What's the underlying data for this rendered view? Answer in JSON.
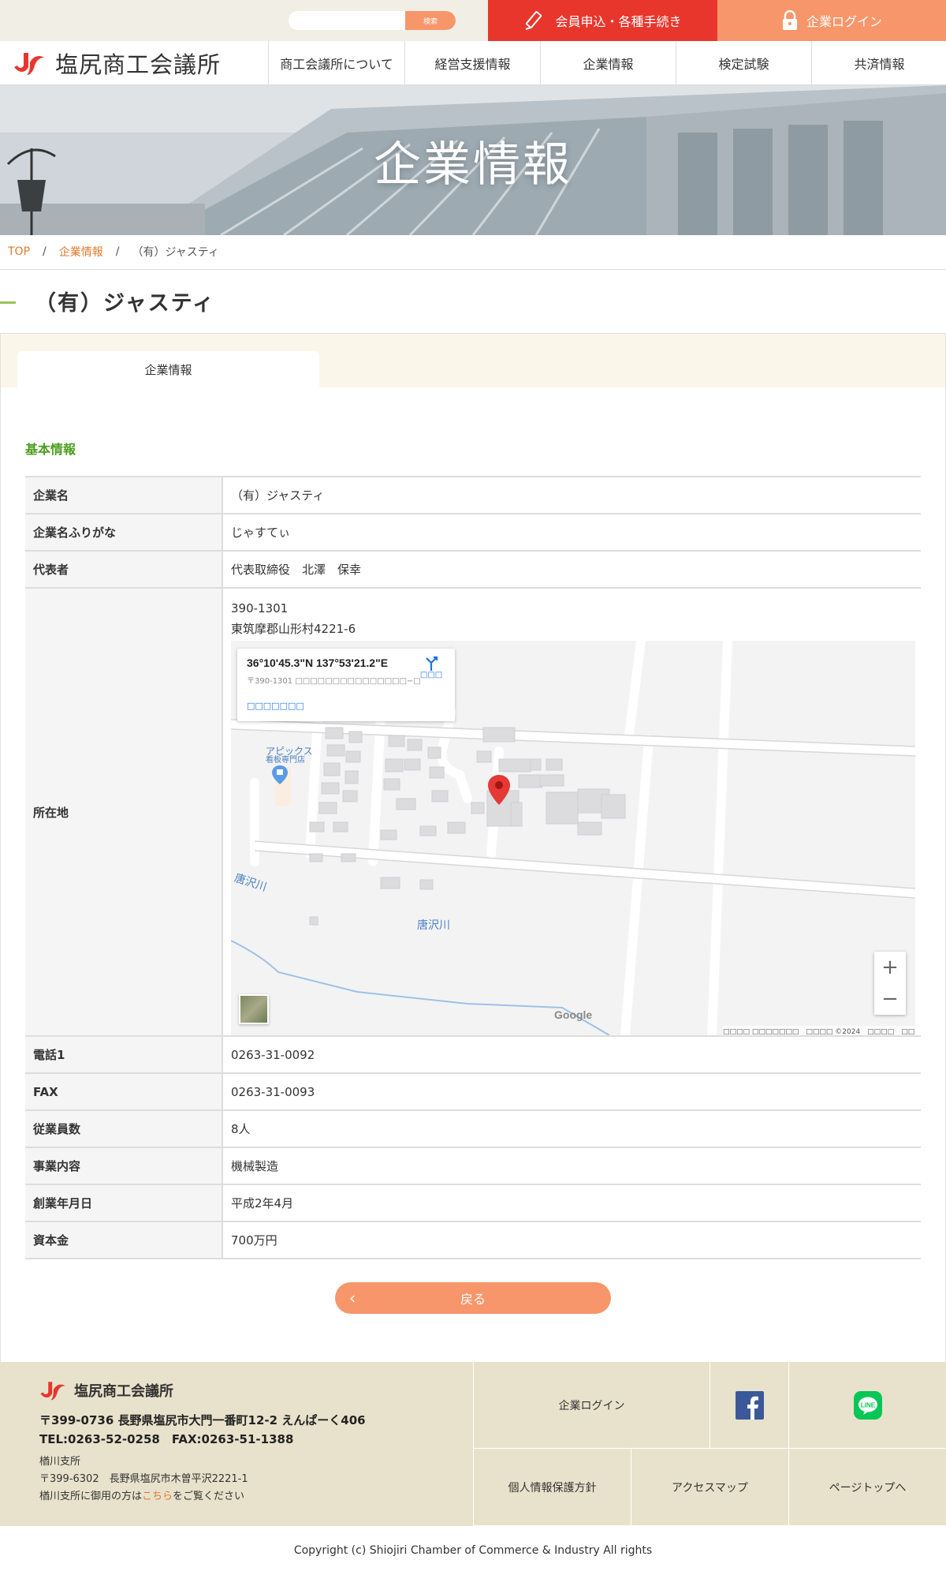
{
  "topbar": {
    "search_placeholder": "",
    "search_button": "検索",
    "member_button": "会員申込・各種手続き",
    "login_button": "企業ログイン"
  },
  "header": {
    "logo_text": "塩尻商工会議所",
    "nav": [
      "商工会議所について",
      "経営支援情報",
      "企業情報",
      "検定試験",
      "共済情報"
    ]
  },
  "hero": {
    "title": "企業情報"
  },
  "breadcrumb": {
    "top": "TOP",
    "category": "企業情報",
    "current": "（有）ジャスティ",
    "separator": "/"
  },
  "page": {
    "title": "（有）ジャスティ",
    "tab": "企業情報",
    "section_title": "基本情報"
  },
  "info": {
    "rows": [
      {
        "label": "企業名",
        "value": "（有）ジャスティ"
      },
      {
        "label": "企業名ふりがな",
        "value": "じゃすてぃ"
      },
      {
        "label": "代表者",
        "value": "代表取締役　北澤　保幸"
      }
    ],
    "address": {
      "label": "所在地",
      "postal": "390-1301",
      "street": "東筑摩郡山形村4221-6"
    },
    "rows2": [
      {
        "label": "電話1",
        "value": "0263-31-0092"
      },
      {
        "label": "FAX",
        "value": "0263-31-0093"
      },
      {
        "label": "従業員数",
        "value": "8人"
      },
      {
        "label": "事業内容",
        "value": "機械製造"
      },
      {
        "label": "創業年月日",
        "value": "平成2年4月"
      },
      {
        "label": "資本金",
        "value": "700万円"
      }
    ]
  },
  "map": {
    "coords": "36°10'45.3\"N 137°53'21.2\"E",
    "sub": "〒390-1301 □□□□□□□□□□□□□□□−□",
    "enlarge": "□□□□□□□",
    "route": "□□□",
    "zoom_in": "+",
    "zoom_out": "−",
    "google": "Google",
    "attribution": "□□□□ □□□□□□□　□□□□ ©2024　□□□□　□□□□□□□□□□□",
    "place_name": "アピックス",
    "place_sub": "看板専門店",
    "river_1": "唐沢川",
    "river_2": "唐沢川"
  },
  "back_button": "戻る",
  "footer": {
    "logo_text": "塩尻商工会議所",
    "address": "〒399-0736 長野県塩尻市大門一番町12-2 えんぱーく406",
    "tel": "TEL:0263-52-0258　FAX:0263-51-1388",
    "branch_name": "楢川支所",
    "branch_address": "〒399-6302　長野県塩尻市木曽平沢2221-1",
    "branch_note_pre": "楢川支所に御用の方は",
    "branch_note_link": "こちら",
    "branch_note_post": "をご覧ください",
    "nav_login": "企業ログイン",
    "nav_privacy": "個人情報保護方針",
    "nav_access": "アクセスマップ",
    "nav_pagetop": "ページトップへ"
  },
  "copyright": "Copyright (c) Shiojiri Chamber of Commerce & Industry All rights",
  "colors": {
    "accent_red": "#e8362d",
    "accent_orange": "#f7966a",
    "green": "#4d9d22",
    "footer_bg": "#e8e2cc"
  }
}
